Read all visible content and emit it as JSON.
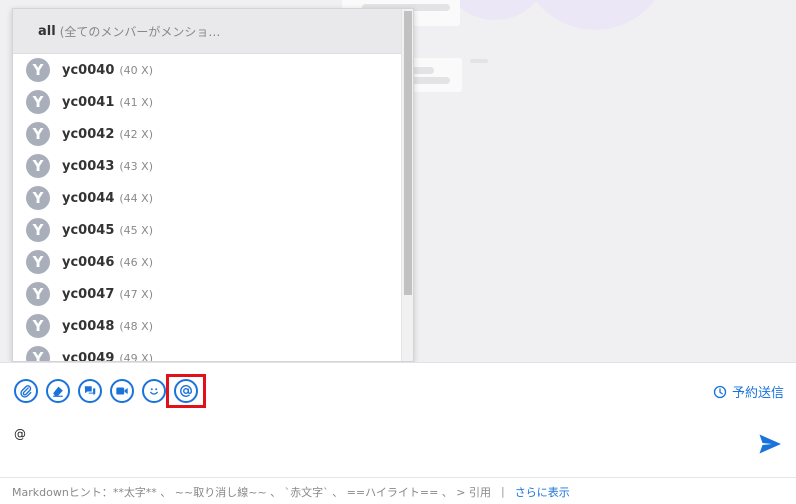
{
  "mention_popup": {
    "all": {
      "name": "all",
      "description": "(全てのメンバーがメンショ…"
    },
    "members": [
      {
        "initial": "Y",
        "name": "yc0040",
        "count": "(40 X)"
      },
      {
        "initial": "Y",
        "name": "yc0041",
        "count": "(41 X)"
      },
      {
        "initial": "Y",
        "name": "yc0042",
        "count": "(42 X)"
      },
      {
        "initial": "Y",
        "name": "yc0043",
        "count": "(43 X)"
      },
      {
        "initial": "Y",
        "name": "yc0044",
        "count": "(44 X)"
      },
      {
        "initial": "Y",
        "name": "yc0045",
        "count": "(45 X)"
      },
      {
        "initial": "Y",
        "name": "yc0046",
        "count": "(46 X)"
      },
      {
        "initial": "Y",
        "name": "yc0047",
        "count": "(47 X)"
      },
      {
        "initial": "Y",
        "name": "yc0048",
        "count": "(48 X)"
      },
      {
        "initial": "Y",
        "name": "yc0049",
        "count": "(49 X)"
      }
    ]
  },
  "toolbar": {
    "icons": [
      "paperclip-icon",
      "eraser-icon",
      "chat-bubbles-icon",
      "video-camera-icon",
      "smiley-icon",
      "at-sign-icon"
    ],
    "schedule_label": "予約送信"
  },
  "composer": {
    "value": "@"
  },
  "hint": {
    "prefix": "Markdownヒント：",
    "items": "**太字** 、 ~~取り消し線~~ 、 `赤文字` 、 ==ハイライト== 、 > 引用",
    "separator": "|",
    "more": "さらに表示"
  },
  "colors": {
    "accent": "#1a73d9",
    "highlight": "#e0101c",
    "avatar": "#a8afbb"
  }
}
